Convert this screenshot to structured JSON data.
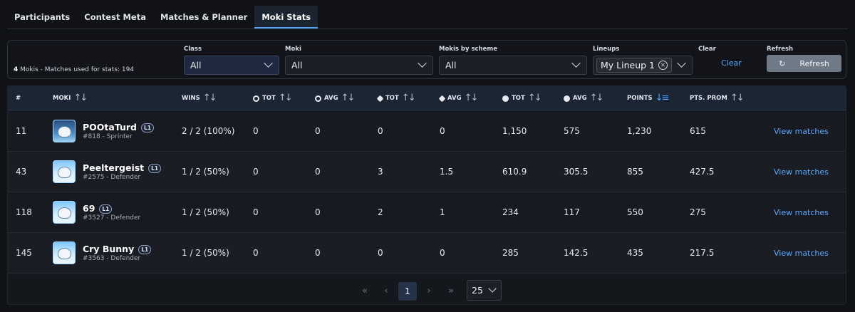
{
  "tabs": [
    {
      "label": "Participants"
    },
    {
      "label": "Contest Meta"
    },
    {
      "label": "Matches & Planner"
    },
    {
      "label": "Moki Stats",
      "active": true
    }
  ],
  "filters": {
    "summary_count": "4",
    "summary_text": " Mokis - Matches used for stats: 194",
    "class": {
      "label": "Class",
      "value": "All"
    },
    "moki": {
      "label": "Moki",
      "value": "All"
    },
    "scheme": {
      "label": "Mokis by scheme",
      "value": "All"
    },
    "lineups": {
      "label": "Lineups",
      "chip": "My Lineup 1"
    },
    "clear": {
      "label": "Clear",
      "link": "Clear"
    },
    "refresh": {
      "label": "Refresh",
      "button": "Refresh",
      "icon": "refresh-icon"
    }
  },
  "table": {
    "headers": {
      "rank": "#",
      "moki": "MOKI",
      "wins": "WINS",
      "t1_tot": "TOT",
      "t1_avg": "AVG",
      "t2_tot": "TOT",
      "t2_avg": "AVG",
      "t3_tot": "TOT",
      "t3_avg": "AVG",
      "points": "POINTS",
      "pts_prom": "PTS. PROM"
    },
    "rows": [
      {
        "rank": "11",
        "name": "POOtaTurd",
        "badge": "L1",
        "sub": "#818 - Sprinter",
        "wins": "2 / 2 (100%)",
        "t1_tot": "0",
        "t1_avg": "0",
        "t2_tot": "0",
        "t2_avg": "0",
        "t3_tot": "1,150",
        "t3_avg": "575",
        "points": "1,230",
        "pts_prom": "615",
        "action": "View matches"
      },
      {
        "rank": "43",
        "name": "Peeltergeist",
        "badge": "L1",
        "sub": "#2575 - Defender",
        "wins": "1 / 2 (50%)",
        "t1_tot": "0",
        "t1_avg": "0",
        "t2_tot": "3",
        "t2_avg": "1.5",
        "t3_tot": "610.9",
        "t3_avg": "305.5",
        "points": "855",
        "pts_prom": "427.5",
        "action": "View matches"
      },
      {
        "rank": "118",
        "name": "69",
        "badge": "L1",
        "sub": "#3527 - Defender",
        "wins": "1 / 2 (50%)",
        "t1_tot": "0",
        "t1_avg": "0",
        "t2_tot": "2",
        "t2_avg": "1",
        "t3_tot": "234",
        "t3_avg": "117",
        "points": "550",
        "pts_prom": "275",
        "action": "View matches"
      },
      {
        "rank": "145",
        "name": "Cry Bunny",
        "badge": "L1",
        "sub": "#3563 - Defender",
        "wins": "1 / 2 (50%)",
        "t1_tot": "0",
        "t1_avg": "0",
        "t2_tot": "0",
        "t2_avg": "0",
        "t3_tot": "285",
        "t3_avg": "142.5",
        "points": "435",
        "pts_prom": "217.5",
        "action": "View matches"
      }
    ]
  },
  "pagination": {
    "first": "«",
    "prev": "‹",
    "current": "1",
    "next": "›",
    "last": "»",
    "page_size": "25"
  },
  "colors": {
    "accent": "#4da3ff",
    "link": "#5aa9ff",
    "background": "#101216"
  }
}
